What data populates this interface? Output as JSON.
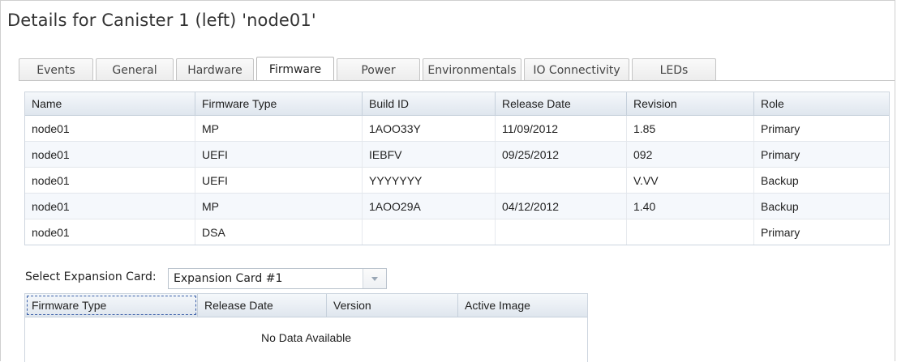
{
  "page": {
    "title": "Details for Canister 1 (left) 'node01'"
  },
  "tabs": [
    {
      "label": "Events",
      "active": false
    },
    {
      "label": "General",
      "active": false
    },
    {
      "label": "Hardware",
      "active": false
    },
    {
      "label": "Firmware",
      "active": true
    },
    {
      "label": "Power",
      "active": false
    },
    {
      "label": "Environmentals",
      "active": false
    },
    {
      "label": "IO Connectivity",
      "active": false
    },
    {
      "label": "LEDs",
      "active": false
    }
  ],
  "firmware_table": {
    "columns": [
      "Name",
      "Firmware Type",
      "Build ID",
      "Release Date",
      "Revision",
      "Role"
    ],
    "rows": [
      [
        "node01",
        "MP",
        "1AOO33Y",
        "11/09/2012",
        "1.85",
        "Primary"
      ],
      [
        "node01",
        "UEFI",
        "IEBFV",
        "09/25/2012",
        "092",
        "Primary"
      ],
      [
        "node01",
        "UEFI",
        "YYYYYYY",
        "",
        "V.VV",
        "Backup"
      ],
      [
        "node01",
        "MP",
        "1AOO29A",
        "04/12/2012",
        "1.40",
        "Backup"
      ],
      [
        "node01",
        "DSA",
        "",
        "",
        "",
        "Primary"
      ]
    ]
  },
  "expansion": {
    "label": "Select Expansion Card:",
    "selected": "Expansion Card #1",
    "columns": [
      "Firmware Type",
      "Release Date",
      "Version",
      "Active Image"
    ],
    "empty_text": "No Data Available"
  },
  "colors": {
    "header_gradient_top": "#f5f8fb",
    "header_gradient_bottom": "#dfe6ee",
    "focus_outline": "#3a5fa8"
  }
}
